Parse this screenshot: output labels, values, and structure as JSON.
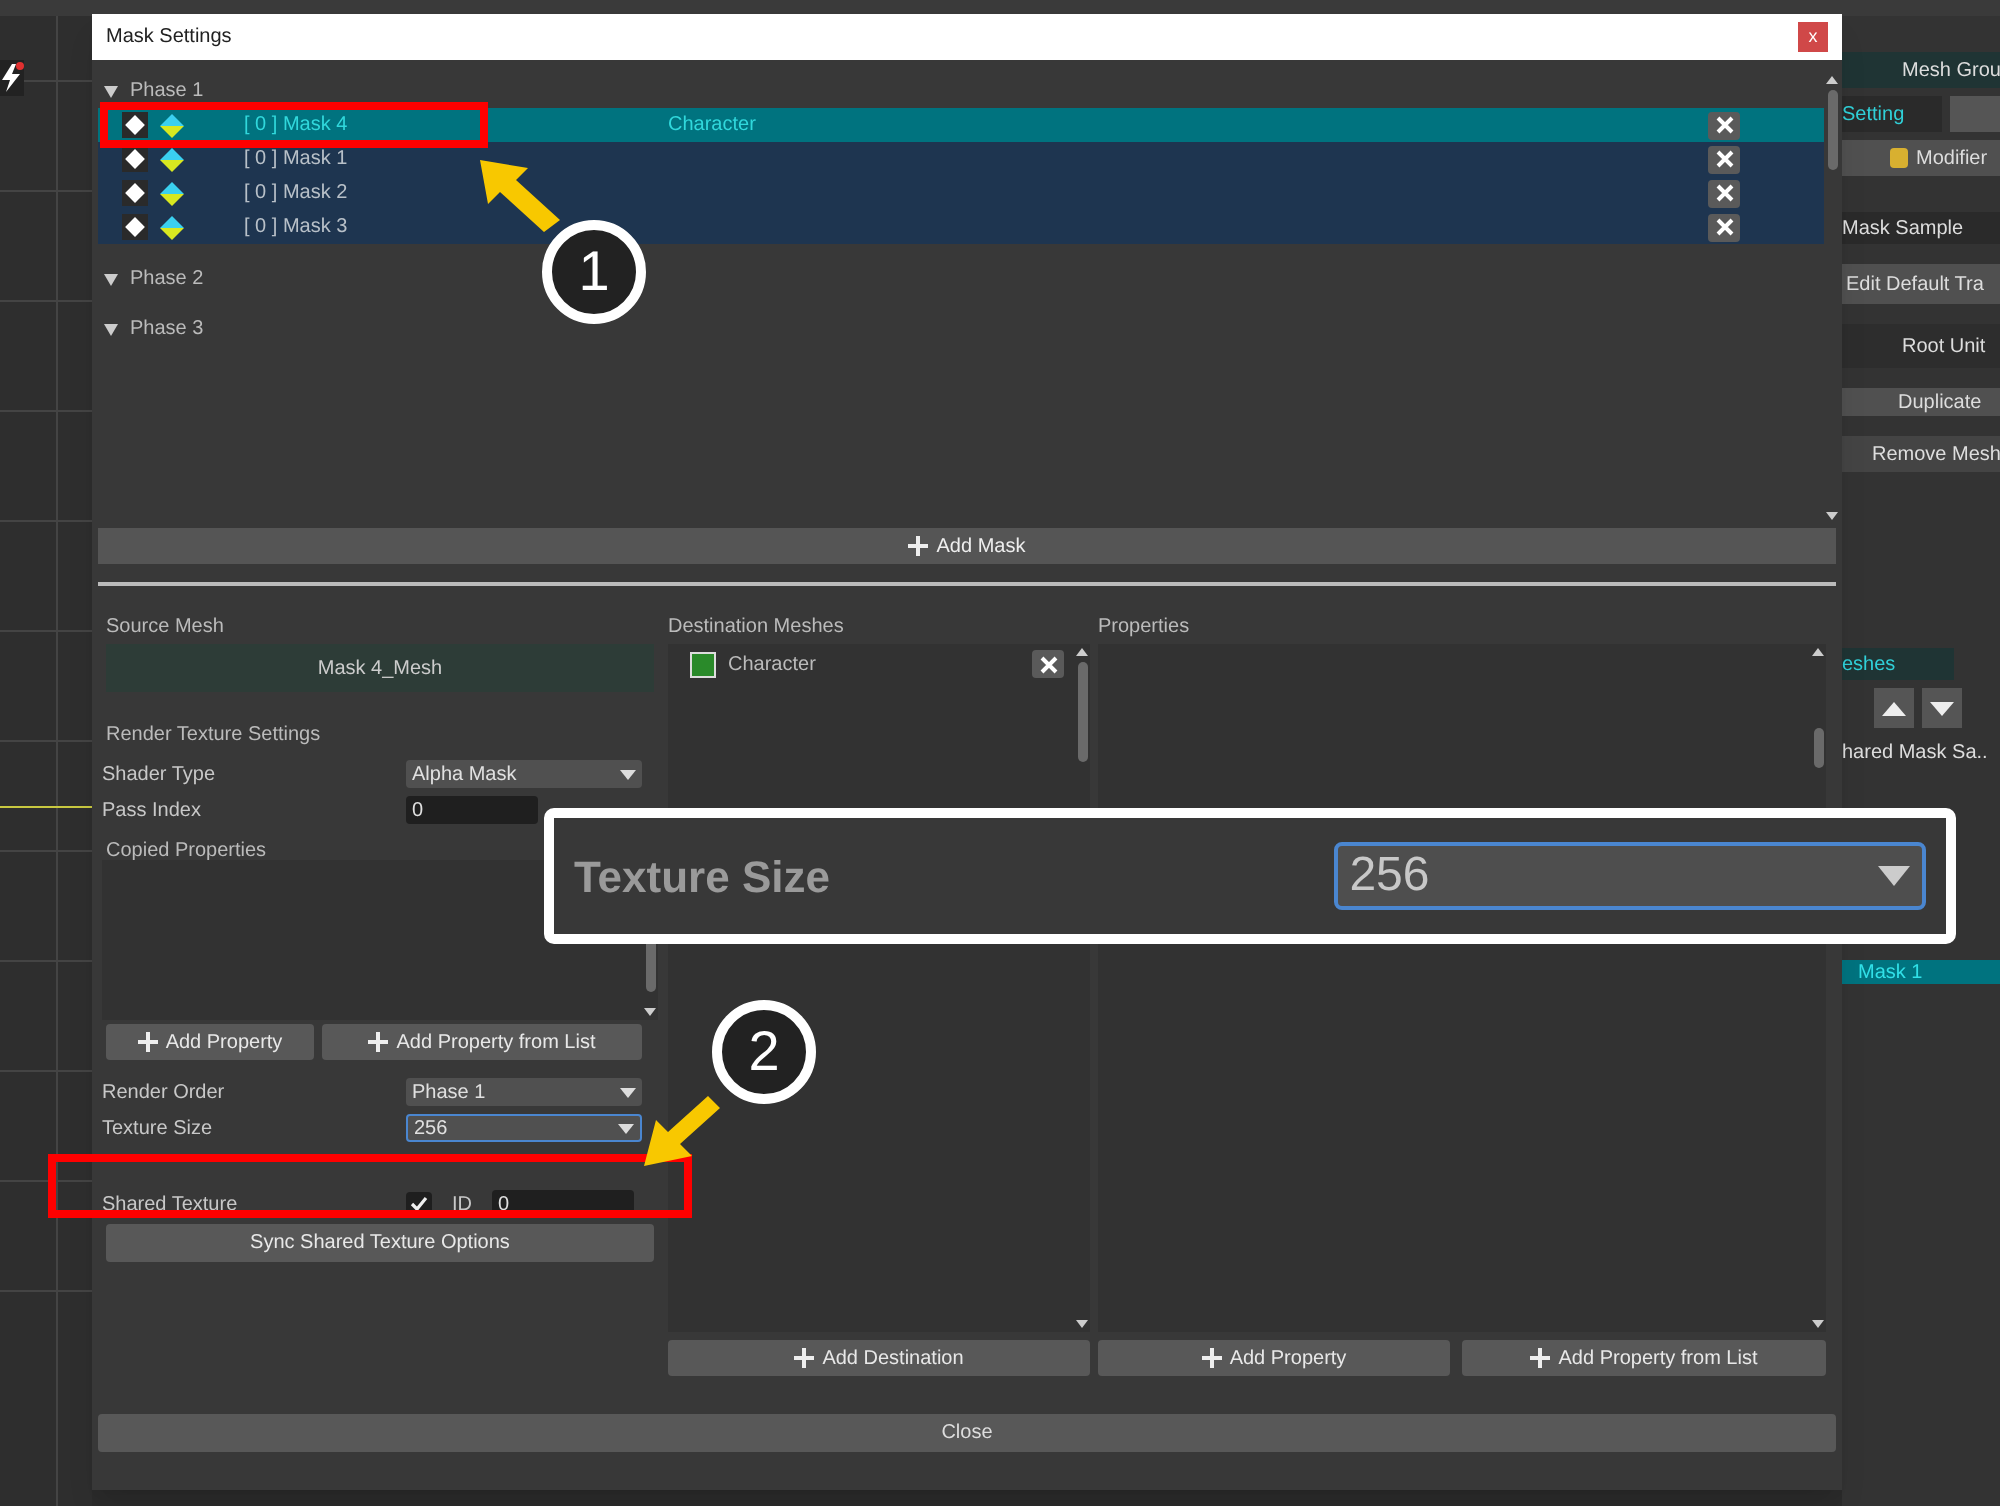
{
  "side_panel": {
    "tab_title": "Mesh Grou",
    "setting_tab": "Setting",
    "modifier": "Modifier",
    "name": "Mask Sample",
    "edit_button": "Edit Default Tra",
    "root_unit": "Root Unit",
    "duplicate": "Duplicate",
    "remove": "Remove Mesh",
    "meshes_tab": "eshes",
    "shared_mask": "hared Mask Sa..",
    "mask_item": "Mask 1"
  },
  "dialog": {
    "title": "Mask Settings",
    "close": "x",
    "phases": [
      {
        "label": "Phase 1",
        "expanded": true,
        "masks": [
          {
            "label": "[ 0 ] Mask 4",
            "target": "Character",
            "selected": true
          },
          {
            "label": "[ 0 ] Mask 1",
            "selected": false
          },
          {
            "label": "[ 0 ] Mask 2",
            "selected": false
          },
          {
            "label": "[ 0 ] Mask 3",
            "selected": false
          }
        ]
      },
      {
        "label": "Phase 2",
        "expanded": true
      },
      {
        "label": "Phase 3",
        "expanded": true
      }
    ],
    "add_mask": "Add Mask",
    "source": {
      "heading": "Source Mesh",
      "mesh": "Mask 4_Mesh"
    },
    "render_heading": "Render Texture Settings",
    "fields_top": [
      {
        "kind": "dropdown",
        "label": "Shader Type",
        "value": "Alpha Mask"
      },
      {
        "kind": "number",
        "label": "Pass Index",
        "value": "0"
      }
    ],
    "copied_heading": "Copied Properties",
    "copied_buttons": [
      "Add Property",
      "Add Property from List"
    ],
    "fields_bottom": [
      {
        "kind": "dropdown",
        "label": "Render Order",
        "value": "Phase 1",
        "focused": false
      },
      {
        "kind": "dropdown",
        "label": "Texture Size",
        "value": "256",
        "focused": true
      },
      {
        "kind": "checkbox_id",
        "label": "Shared Texture",
        "checked": true,
        "id_label": "ID",
        "id_value": "0"
      }
    ],
    "sync_button": "Sync Shared Texture Options",
    "destination": {
      "heading": "Destination Meshes",
      "items": [
        {
          "name": "Character"
        }
      ],
      "button": "Add Destination"
    },
    "properties": {
      "heading": "Properties",
      "buttons": [
        "Add Property",
        "Add Property from List"
      ]
    },
    "close_button": "Close"
  },
  "annotations": {
    "callouts": [
      {
        "number": "1"
      },
      {
        "number": "2"
      }
    ],
    "magnifier": {
      "label": "Texture Size",
      "value": "256"
    }
  }
}
